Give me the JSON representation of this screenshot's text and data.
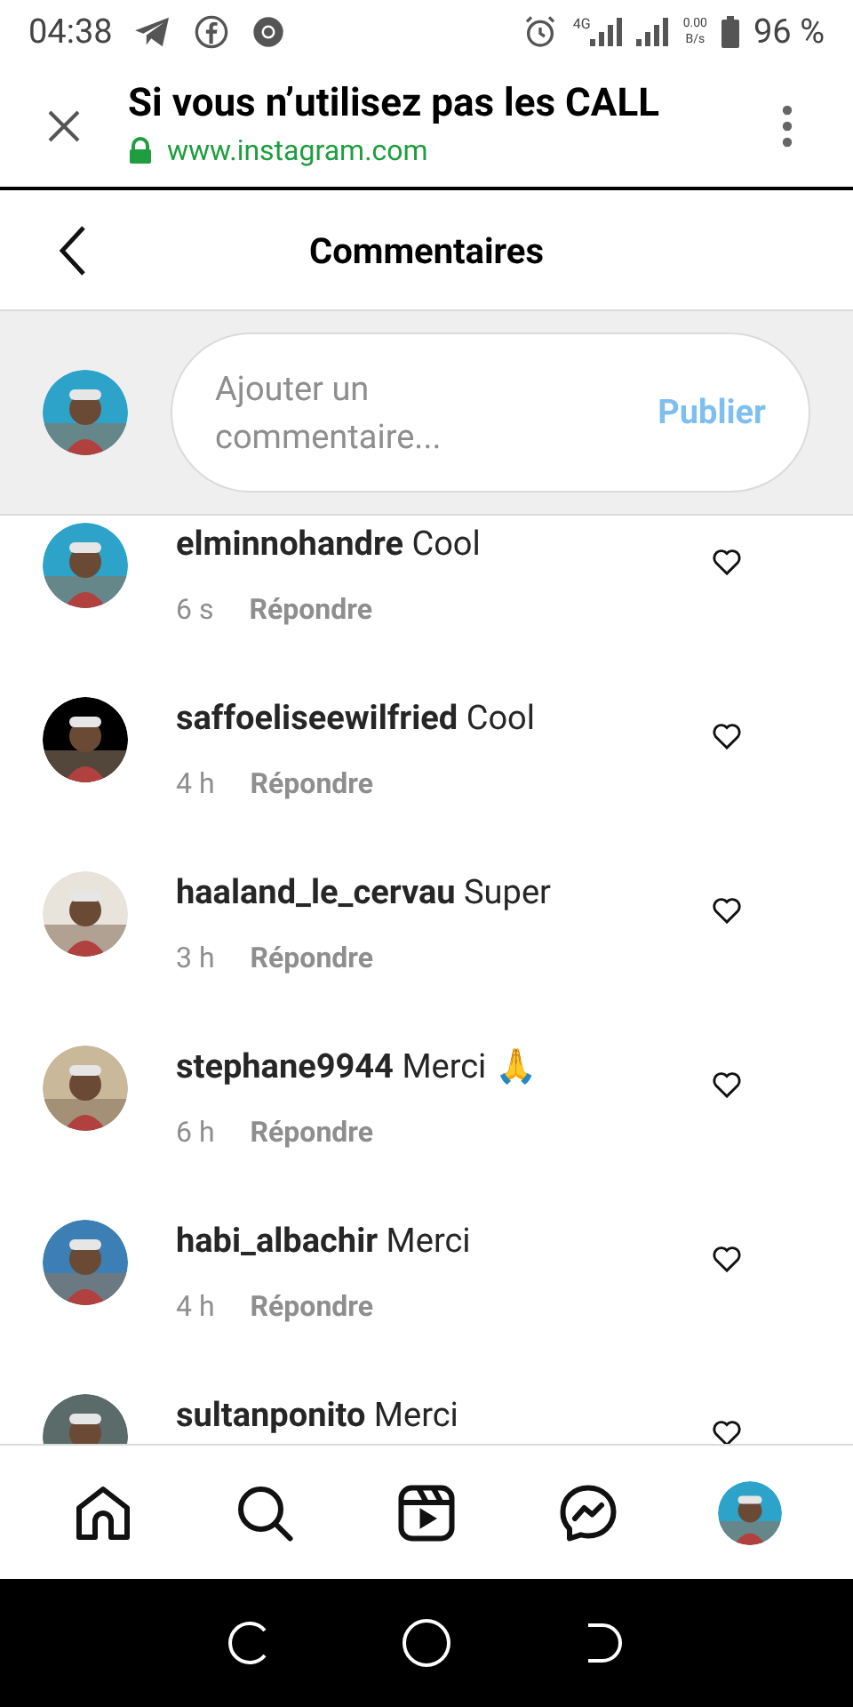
{
  "status_bar": {
    "time": "04:38",
    "network": "4G",
    "speed_value": "0.00",
    "speed_unit": "B/s",
    "battery": "96 %"
  },
  "browser": {
    "title": "Si vous n’utilisez pas les CALL",
    "url": "www.instagram.com"
  },
  "header": {
    "title": "Commentaires"
  },
  "composer": {
    "placeholder": "Ajouter un commentaire...",
    "button": "Publier",
    "disabled": true
  },
  "comments": [
    {
      "user": "elminnohandre",
      "text": "Cool",
      "time": "6 s",
      "reply": "Répondre",
      "color": "#2ea3c9"
    },
    {
      "user": "saffoeliseewilfried",
      "text": "Cool",
      "time": "4 h",
      "reply": "Répondre",
      "color": "#000000"
    },
    {
      "user": "haaland_le_cervau",
      "text": "Super",
      "time": "3 h",
      "reply": "Répondre",
      "color": "#e8e4dc"
    },
    {
      "user": "stephane9944",
      "text": "Merci 🙏",
      "time": "6 h",
      "reply": "Répondre",
      "color": "#c9b89a"
    },
    {
      "user": "habi_albachir",
      "text": "Merci",
      "time": "4 h",
      "reply": "Répondre",
      "color": "#3b7fb5"
    },
    {
      "user": "sultanponito",
      "text": "Merci",
      "color": "#5a6b6a"
    }
  ],
  "nav": [
    {
      "kind": "home"
    },
    {
      "kind": "search"
    },
    {
      "kind": "reels"
    },
    {
      "kind": "messenger"
    },
    {
      "kind": "profile"
    }
  ]
}
